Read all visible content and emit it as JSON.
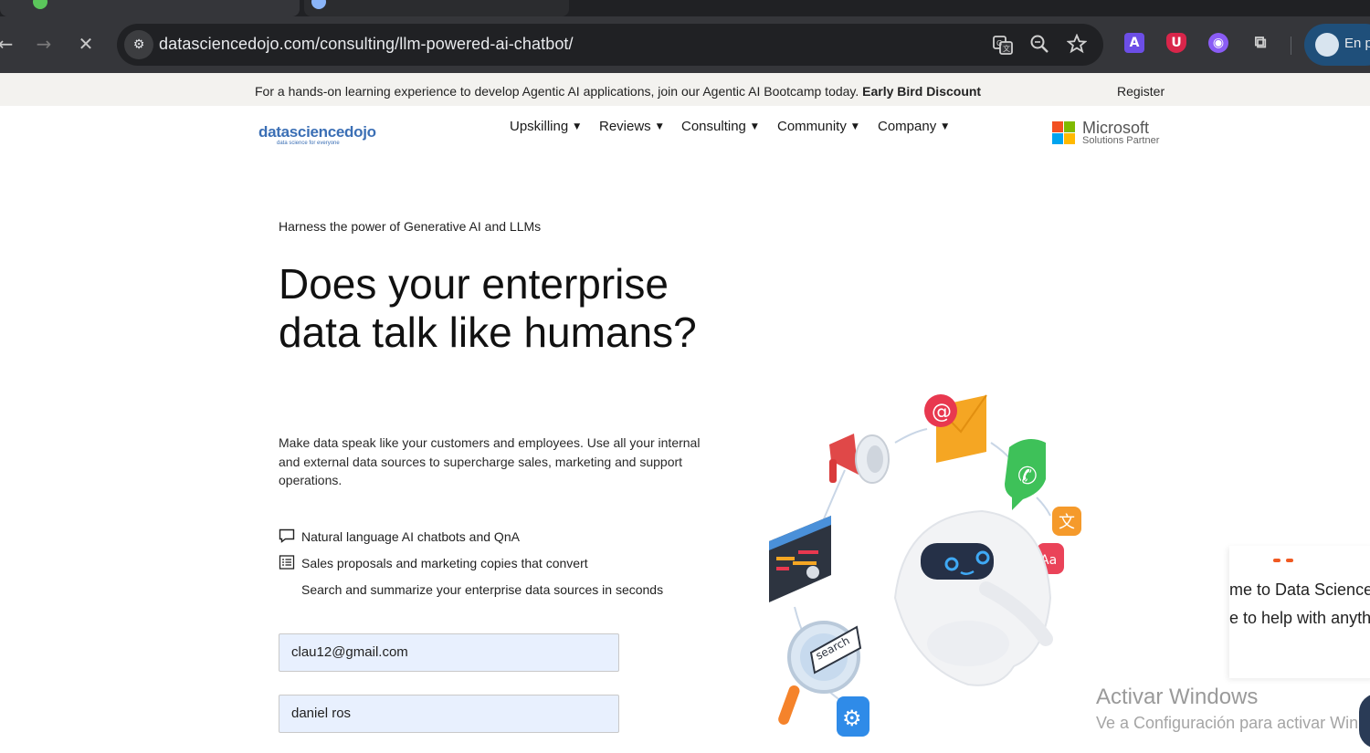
{
  "browser": {
    "url": "datasciencedojo.com/consulting/llm-powered-ai-chatbot/",
    "profile_label": "En p",
    "extensions": [
      {
        "name": "translate-icon"
      },
      {
        "name": "zoom-icon"
      },
      {
        "name": "bookmark-star-icon"
      }
    ]
  },
  "announcement": {
    "text": "For a hands-on learning experience to develop Agentic AI applications, join our Agentic AI Bootcamp today.",
    "highlight": "Early Bird Discount",
    "register": "Register"
  },
  "header": {
    "logo": "datasciencedojo",
    "logo_tagline": "data science for everyone",
    "nav": [
      "Upskilling",
      "Reviews",
      "Consulting",
      "Community",
      "Company"
    ],
    "partner_title": "Microsoft",
    "partner_sub": "Solutions Partner"
  },
  "hero": {
    "kicker": "Harness the power of Generative AI and LLMs",
    "headline": "Does your enterprise data talk like humans?",
    "lead": "Make data speak like your customers and employees. Use all your internal and external data sources to supercharge sales, marketing and support operations.",
    "features": [
      "Natural language AI chatbots and QnA",
      "Sales proposals and marketing copies that convert",
      "Search and summarize your enterprise data sources in seconds"
    ]
  },
  "form": {
    "email_value": "clau12@gmail.com",
    "name_value": "daniel ros"
  },
  "illustration": {
    "search_label": "search"
  },
  "chat_popup": {
    "line1": "me to Data Science",
    "line2": "e to help with anyth"
  },
  "watermark": {
    "line1": "Activar Windows",
    "line2": "Ve a Configuración para activar Win"
  },
  "colors": {
    "brand_blue": "#3b6fb5",
    "field_bg": "#e8f0fe",
    "announce_bg": "#f3f2ef"
  }
}
